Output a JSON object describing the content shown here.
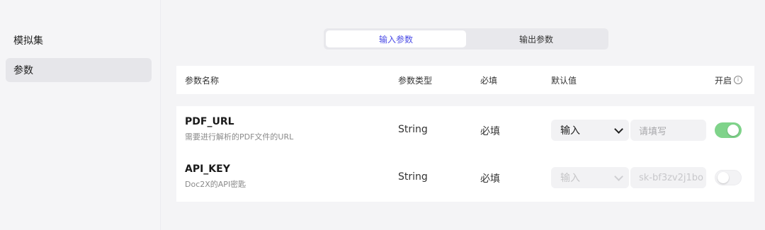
{
  "sidebar": {
    "items": [
      {
        "label": "模拟集",
        "active": false
      },
      {
        "label": "参数",
        "active": true
      }
    ]
  },
  "tabs": [
    {
      "label": "输入参数",
      "active": true
    },
    {
      "label": "输出参数",
      "active": false
    }
  ],
  "table": {
    "headers": {
      "name": "参数名称",
      "type": "参数类型",
      "required": "必填",
      "default": "默认值",
      "enabled": "开启"
    },
    "rows": [
      {
        "name": "PDF_URL",
        "description": "需要进行解析的PDF文件的URL",
        "type": "String",
        "required": "必填",
        "default_mode": "输入",
        "default_placeholder": "请填写",
        "default_value": "",
        "enabled": true
      },
      {
        "name": "API_KEY",
        "description": "Doc2X的API密匙",
        "type": "String",
        "required": "必填",
        "default_mode": "输入",
        "default_placeholder": "",
        "default_value": "sk-bf3zv2j1bo",
        "enabled": false
      }
    ]
  },
  "colors": {
    "accent": "#4b4ce6",
    "toggle_on": "#7fd38a"
  }
}
